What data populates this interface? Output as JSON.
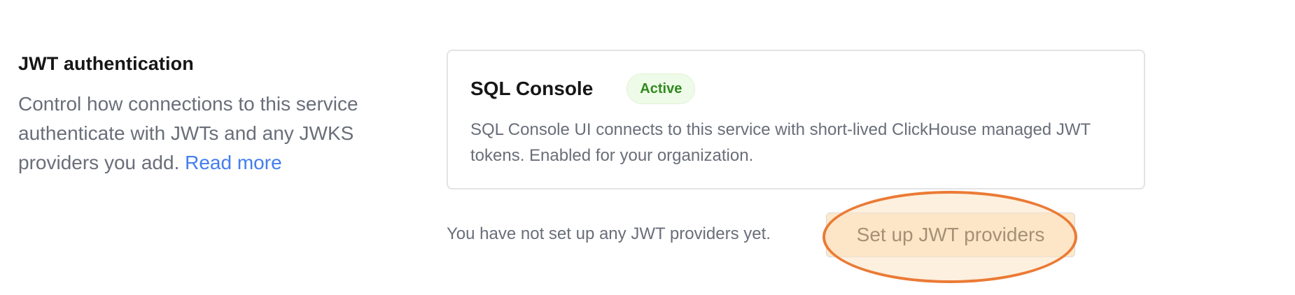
{
  "section": {
    "title": "JWT authentication",
    "description": "Control how connections to this service authenticate with JWTs and any JWKS providers you add. ",
    "read_more_label": "Read more"
  },
  "sql_console_card": {
    "title": "SQL Console",
    "status_badge": "Active",
    "description": "SQL Console UI connects to this service with short-lived ClickHouse managed JWT tokens. Enabled for your organization."
  },
  "providers": {
    "empty_message": "You have not set up any JWT providers yet.",
    "setup_button_label": "Set up JWT providers"
  },
  "colors": {
    "link": "#437eef",
    "badge_bg": "#effbe9",
    "badge_text": "#2f8a1e",
    "highlight_ring": "#eb7a35",
    "highlight_fill": "#fde9cb"
  }
}
